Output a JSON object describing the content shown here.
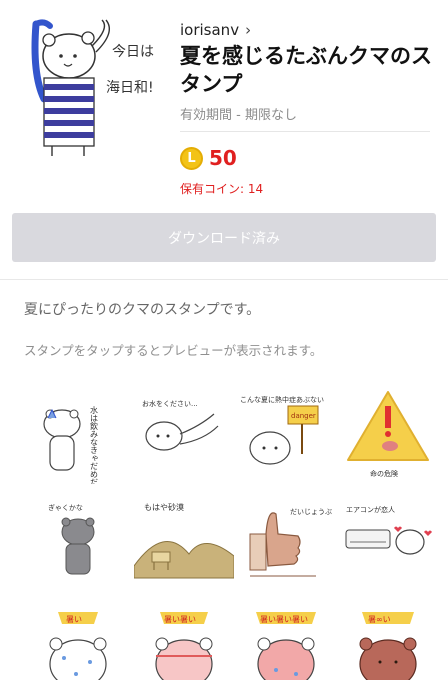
{
  "product": {
    "author": "iorisanv",
    "author_chevron": "›",
    "title": "夏を感じるたぶんクマのスタンプ",
    "validity": "有効期間 - 期限なし",
    "coin_symbol": "L",
    "price": "50",
    "coins_held": "保有コイン: 14"
  },
  "main_sticker": {
    "text": "今日は海日和!"
  },
  "actions": {
    "download_label": "ダウンロード済み"
  },
  "description": {
    "text": "夏にぴったりのクマのスタンプです。",
    "hint": "スタンプをタップするとプレビューが表示されます。"
  },
  "stickers": [
    {
      "name": "sticker-water-bear",
      "text": "水は飲みなきゃだめだよ"
    },
    {
      "name": "sticker-lying-bear",
      "text": "お水をください..."
    },
    {
      "name": "sticker-danger-sign-bear",
      "text": "こんな夏に熱中症あぶない",
      "sign": "danger"
    },
    {
      "name": "sticker-warning-triangle",
      "text": "命の危険"
    },
    {
      "name": "sticker-grey-bear",
      "text": "ぎゃくかな"
    },
    {
      "name": "sticker-desert-camel",
      "text": "もはや砂漠"
    },
    {
      "name": "sticker-thumbs-up",
      "text": "だいじょうぶ"
    },
    {
      "name": "sticker-air-conditioner",
      "text": "エアコンが恋人"
    },
    {
      "name": "sticker-sweating-bear-1",
      "text": "暑い"
    },
    {
      "name": "sticker-sweating-bear-2",
      "text": "暑い暑い"
    },
    {
      "name": "sticker-sweating-bear-3",
      "text": "暑い暑い暑い"
    },
    {
      "name": "sticker-red-bear",
      "text": "暑∞い"
    }
  ],
  "colors": {
    "price_red": "#e02020",
    "coin_gold": "#f3c317",
    "button_disabled": "#d9d9de",
    "stripe_navy": "#3d3d9e",
    "warning_yellow": "#f5cf4a"
  }
}
